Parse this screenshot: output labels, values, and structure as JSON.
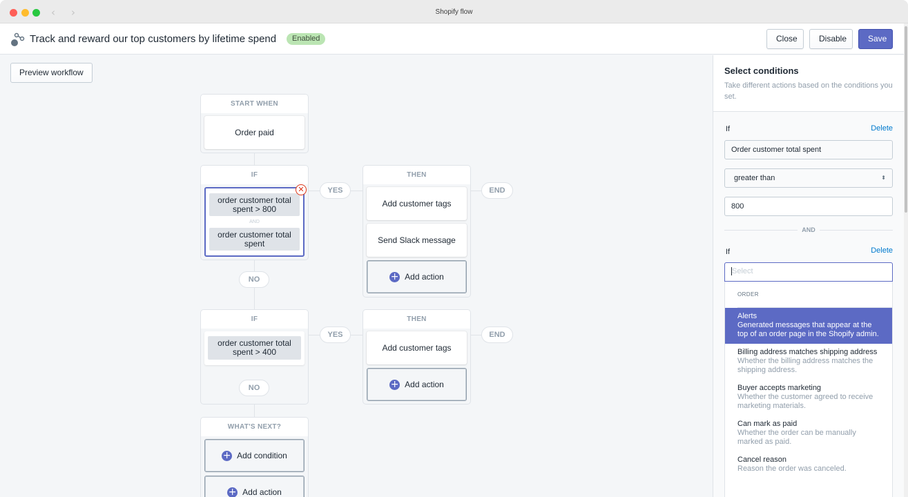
{
  "window": {
    "title": "Shopify flow"
  },
  "header": {
    "workflow_title": "Track and reward our top customers by lifetime spend",
    "status_badge": "Enabled",
    "close_label": "Close",
    "disable_label": "Disable",
    "save_label": "Save"
  },
  "canvas": {
    "preview_label": "Preview workflow",
    "start": {
      "heading": "START WHEN",
      "trigger": "Order paid"
    },
    "if1": {
      "heading": "IF",
      "conditions": [
        "order customer total spent > 800",
        "order customer total spent"
      ],
      "joiner": "AND"
    },
    "yes1": "YES",
    "then1": {
      "heading": "THEN",
      "actions": [
        "Add customer tags",
        "Send Slack message"
      ],
      "add_action": "Add action"
    },
    "end1": "END",
    "no1": "NO",
    "if2": {
      "heading": "IF",
      "conditions": [
        "order customer total spent > 400"
      ]
    },
    "yes2": "YES",
    "then2": {
      "heading": "THEN",
      "actions": [
        "Add customer tags"
      ],
      "add_action": "Add action"
    },
    "end2": "END",
    "no2": "NO",
    "next": {
      "heading": "WHAT'S NEXT?",
      "add_condition": "Add condition",
      "add_action": "Add action"
    }
  },
  "panel": {
    "title": "Select conditions",
    "description": "Take different actions based on the conditions you set.",
    "condition1": {
      "label": "If",
      "delete_label": "Delete",
      "field": "Order customer total spent",
      "operator": "greater than",
      "value": "800"
    },
    "and_label": "AND",
    "condition2": {
      "label": "If",
      "delete_label": "Delete",
      "placeholder": "Select"
    },
    "dropdown": {
      "section": "ORDER",
      "options": [
        {
          "title": "Alerts",
          "desc": "Generated messages that appear at the top of an order page in the Shopify admin.",
          "active": true
        },
        {
          "title": "Billing address matches shipping address",
          "desc": "Whether the billing address matches the shipping address."
        },
        {
          "title": "Buyer accepts marketing",
          "desc": "Whether the customer agreed to receive marketing materials."
        },
        {
          "title": "Can mark as paid",
          "desc": "Whether the order can be manually marked as paid."
        },
        {
          "title": "Cancel reason",
          "desc": "Reason the order was canceled."
        }
      ]
    }
  },
  "colors": {
    "accent": "#5c6ac4",
    "badge_bg": "#bbe5b3",
    "link": "#007ace",
    "error": "#de3618"
  }
}
